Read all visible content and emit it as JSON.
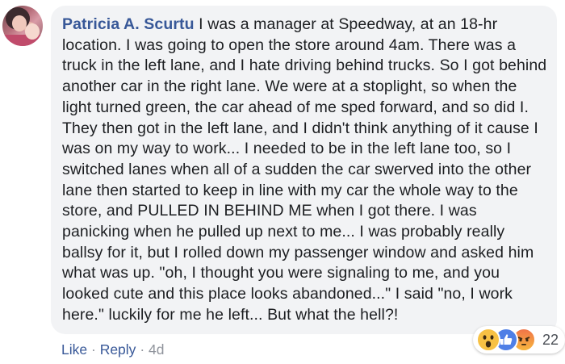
{
  "comment": {
    "author": "Patricia A. Scurtu",
    "body": "I was a manager at Speedway, at an 18-hr location. I was going to open the store around 4am. There was a truck in the left lane, and I hate driving behind trucks. So I got behind another car in the right lane. We were at a stoplight, so when the light turned green, the car ahead of me sped forward, and so did I. They then got in the left lane, and I didn't think anything of it cause I was on my way to work... I needed to be in the left lane too, so I switched lanes when all of a sudden the car swerved into the other lane then started to keep in line with my car the whole way to the store, and PULLED IN BEHIND ME when I got there. I was panicking when he pulled up next to me... I was probably really ballsy for it, but I rolled down my passenger window and asked him what was up. \"oh, I thought you were signaling to me, and you looked cute and this place looks abandoned...\" I said \"no, I work here.\" luckily for me he left... But what the hell?!"
  },
  "actions": {
    "like_label": "Like",
    "separator": "·",
    "reply_label": "Reply",
    "time": "4d"
  },
  "reactions": {
    "icons": [
      "wow-reaction-icon",
      "like-reaction-icon",
      "angry-reaction-icon"
    ],
    "count": "22",
    "colors": {
      "wow": "#f7c144",
      "like": "#4f7fe6",
      "angry": "#f07448"
    }
  },
  "colors": {
    "author_link": "#385898",
    "bubble_bg": "#f2f3f5",
    "text": "#1c1e21",
    "meta": "#90949c"
  }
}
